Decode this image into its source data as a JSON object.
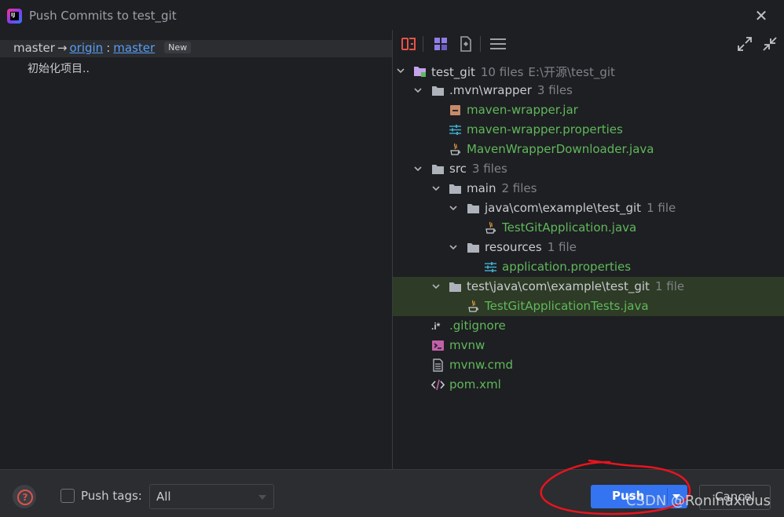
{
  "window": {
    "title": "Push Commits to test_git"
  },
  "branch": {
    "local": "master",
    "arrow": "→",
    "remote": "origin",
    "colon": ":",
    "remote_branch": "master",
    "badge": "New"
  },
  "commit": {
    "message": "初始化项目.."
  },
  "tree": {
    "root": {
      "name": "test_git",
      "count": "10 files",
      "path": "E:\\开源\\test_git"
    },
    "mvn": {
      "name": ".mvn\\wrapper",
      "count": "3 files"
    },
    "mvn_jar": {
      "name": "maven-wrapper.jar"
    },
    "mvn_props": {
      "name": "maven-wrapper.properties"
    },
    "mvn_java": {
      "name": "MavenWrapperDownloader.java"
    },
    "src": {
      "name": "src",
      "count": "3 files"
    },
    "main": {
      "name": "main",
      "count": "2 files"
    },
    "main_java": {
      "name": "java\\com\\example\\test_git",
      "count": "1 file"
    },
    "app_java": {
      "name": "TestGitApplication.java"
    },
    "resources": {
      "name": "resources",
      "count": "1 file"
    },
    "app_props": {
      "name": "application.properties"
    },
    "test_java": {
      "name": "test\\java\\com\\example\\test_git",
      "count": "1 file"
    },
    "app_tests": {
      "name": "TestGitApplicationTests.java"
    },
    "gitignore": {
      "name": ".gitignore"
    },
    "mvnw": {
      "name": "mvnw"
    },
    "mvnw_cmd": {
      "name": "mvnw.cmd"
    },
    "pom": {
      "name": "pom.xml"
    }
  },
  "footer": {
    "push_tags_label": "Push tags:",
    "push_tags_value": "All",
    "push_label": "Push",
    "cancel_label": "Cancel"
  },
  "watermark": "CSDN @Roninaxious",
  "colors": {
    "accent": "#3574f0",
    "added_file": "#5fb85b",
    "link": "#589df6",
    "annotation": "#e8141e"
  }
}
